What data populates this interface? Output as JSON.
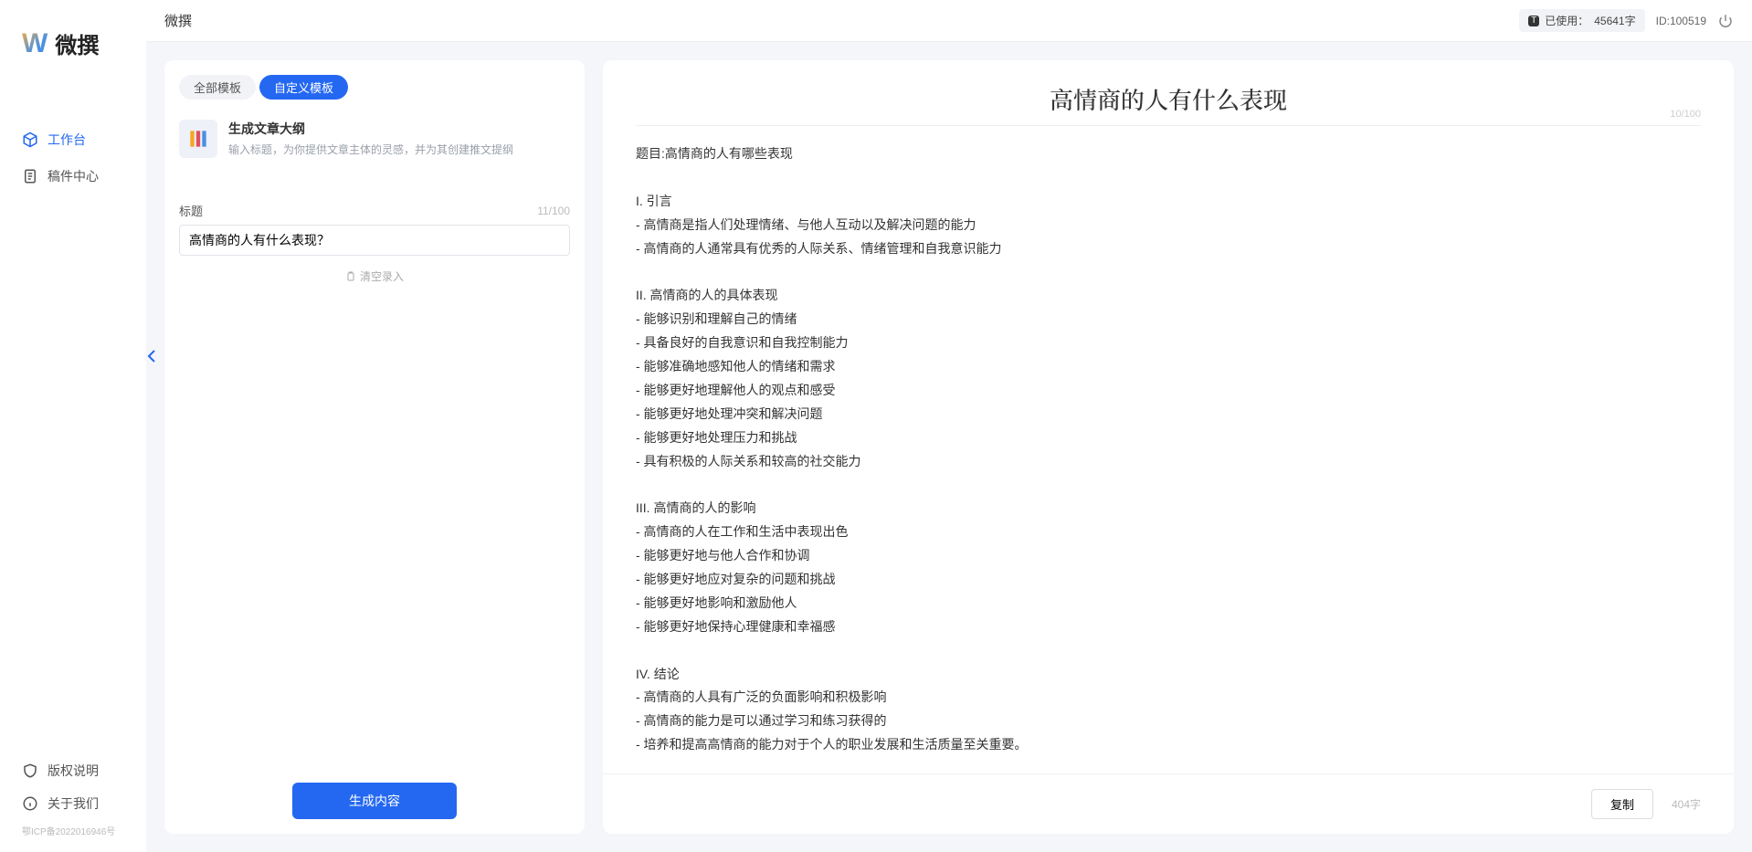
{
  "app": {
    "logo_text": "微撰"
  },
  "sidebar": {
    "nav": [
      {
        "label": "工作台",
        "icon": "cube-icon",
        "active": true
      },
      {
        "label": "稿件中心",
        "icon": "doc-icon",
        "active": false
      }
    ],
    "bottom": [
      {
        "label": "版权说明",
        "icon": "shield-icon"
      },
      {
        "label": "关于我们",
        "icon": "info-icon"
      }
    ],
    "icp": "鄂ICP备2022016946号"
  },
  "topbar": {
    "title": "微撰",
    "usage_prefix": "已使用：",
    "usage_value": "45641字",
    "id_label": "ID:100519"
  },
  "left": {
    "tabs": [
      {
        "label": "全部模板"
      },
      {
        "label": "自定义模板"
      }
    ],
    "active_tab": 1,
    "template": {
      "title": "生成文章大纲",
      "desc": "输入标题，为你提供文章主体的灵感，并为其创建推文提纲"
    },
    "form": {
      "label": "标题",
      "counter": "11/100",
      "value": "高情商的人有什么表现？",
      "paste": "清空录入"
    },
    "generate": "生成内容"
  },
  "right": {
    "title": "高情商的人有什么表现",
    "title_counter": "10/100",
    "body": "题目:高情商的人有哪些表现\n\nI. 引言\n- 高情商是指人们处理情绪、与他人互动以及解决问题的能力\n- 高情商的人通常具有优秀的人际关系、情绪管理和自我意识能力\n\nII. 高情商的人的具体表现\n- 能够识别和理解自己的情绪\n- 具备良好的自我意识和自我控制能力\n- 能够准确地感知他人的情绪和需求\n- 能够更好地理解他人的观点和感受\n- 能够更好地处理冲突和解决问题\n- 能够更好地处理压力和挑战\n- 具有积极的人际关系和较高的社交能力\n\nIII. 高情商的人的影响\n- 高情商的人在工作和生活中表现出色\n- 能够更好地与他人合作和协调\n- 能够更好地应对复杂的问题和挑战\n- 能够更好地影响和激励他人\n- 能够更好地保持心理健康和幸福感\n\nIV. 结论\n- 高情商的人具有广泛的负面影响和积极影响\n- 高情商的能力是可以通过学习和练习获得的\n- 培养和提高高情商的能力对于个人的职业发展和生活质量至关重要。",
    "copy": "复制",
    "word_count": "404字"
  }
}
